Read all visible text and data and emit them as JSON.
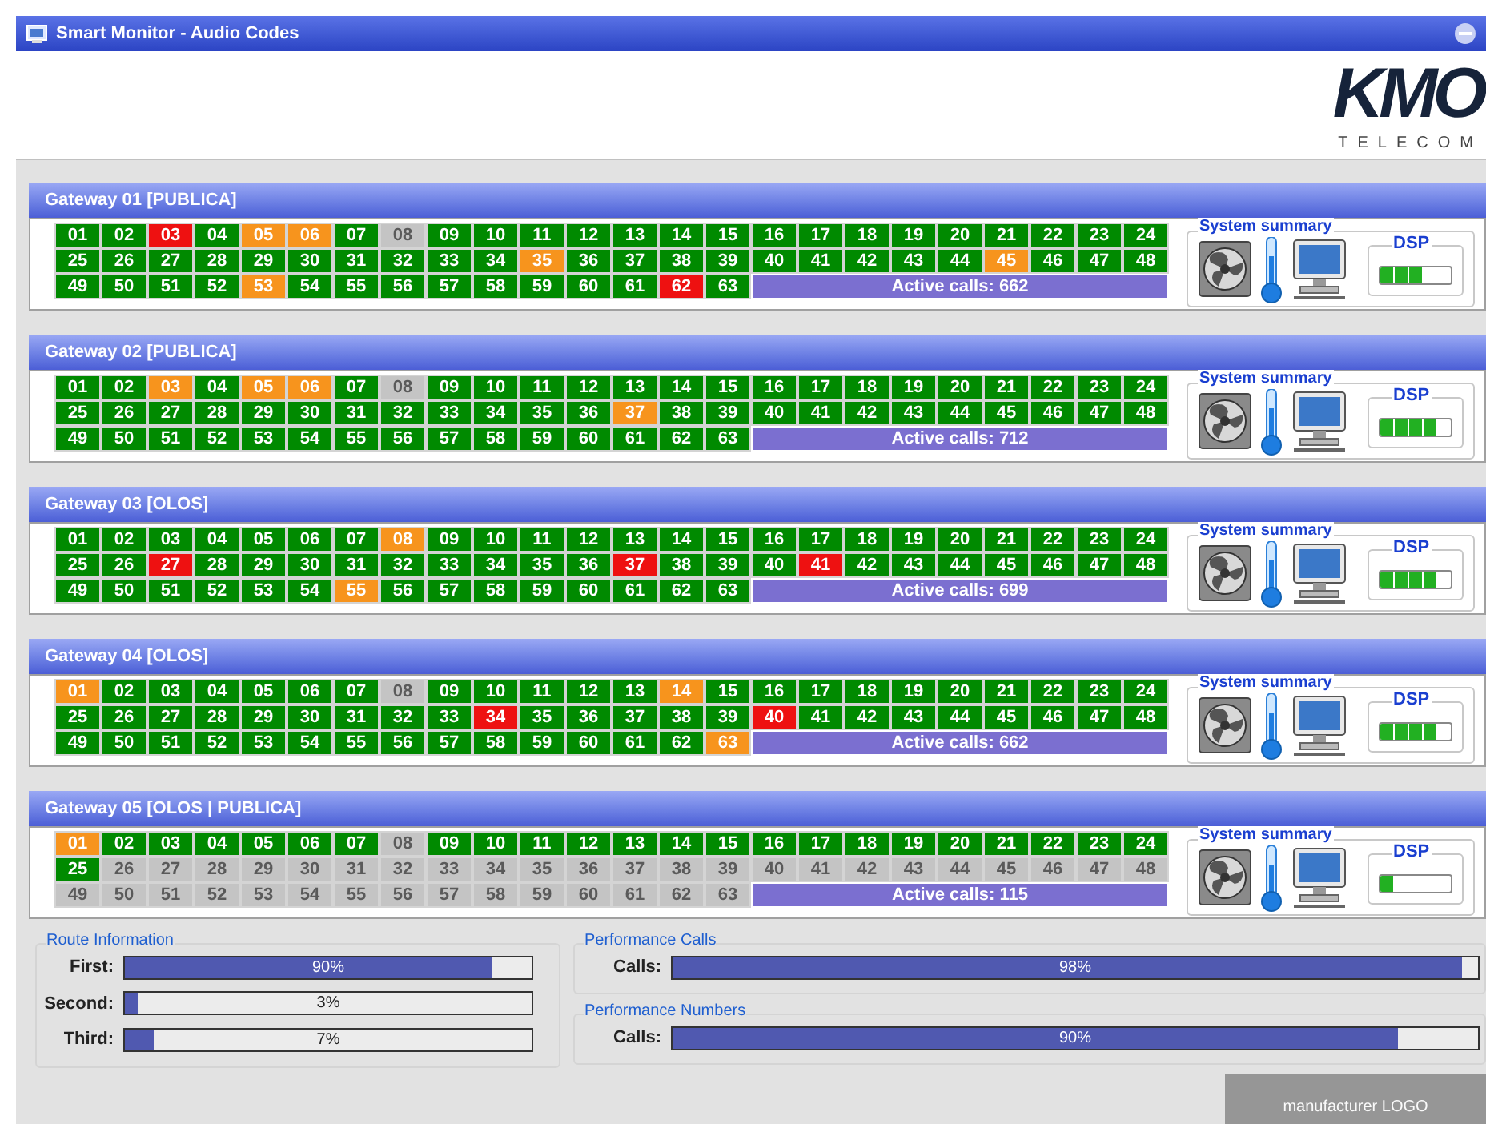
{
  "window": {
    "title": "Smart Monitor - Audio Codes"
  },
  "logo": {
    "mark": "KMO",
    "tagline": "TELECOM"
  },
  "gateways": [
    {
      "title": "Gateway 01 [PUBLICA]",
      "active_calls": "Active calls: 662",
      "summary": {
        "title": "System summary",
        "dsp": {
          "label": "DSP",
          "level": 0.6
        }
      },
      "channels": [
        {
          "n": "01",
          "color": "#008a00"
        },
        {
          "n": "02",
          "color": "#008a00"
        },
        {
          "n": "03",
          "color": "#ee1111"
        },
        {
          "n": "04",
          "color": "#008a00"
        },
        {
          "n": "05",
          "color": "#f7941d"
        },
        {
          "n": "06",
          "color": "#f7941d"
        },
        {
          "n": "07",
          "color": "#008a00"
        },
        {
          "n": "08",
          "color": "#c4c4c4"
        },
        {
          "n": "09",
          "color": "#008a00"
        },
        {
          "n": "10",
          "color": "#008a00"
        },
        {
          "n": "11",
          "color": "#008a00"
        },
        {
          "n": "12",
          "color": "#008a00"
        },
        {
          "n": "13",
          "color": "#008a00"
        },
        {
          "n": "14",
          "color": "#008a00"
        },
        {
          "n": "15",
          "color": "#008a00"
        },
        {
          "n": "16",
          "color": "#008a00"
        },
        {
          "n": "17",
          "color": "#008a00"
        },
        {
          "n": "18",
          "color": "#008a00"
        },
        {
          "n": "19",
          "color": "#008a00"
        },
        {
          "n": "20",
          "color": "#008a00"
        },
        {
          "n": "21",
          "color": "#008a00"
        },
        {
          "n": "22",
          "color": "#008a00"
        },
        {
          "n": "23",
          "color": "#008a00"
        },
        {
          "n": "24",
          "color": "#008a00"
        },
        {
          "n": "25",
          "color": "#008a00"
        },
        {
          "n": "26",
          "color": "#008a00"
        },
        {
          "n": "27",
          "color": "#008a00"
        },
        {
          "n": "28",
          "color": "#008a00"
        },
        {
          "n": "29",
          "color": "#008a00"
        },
        {
          "n": "30",
          "color": "#008a00"
        },
        {
          "n": "31",
          "color": "#008a00"
        },
        {
          "n": "32",
          "color": "#008a00"
        },
        {
          "n": "33",
          "color": "#008a00"
        },
        {
          "n": "34",
          "color": "#008a00"
        },
        {
          "n": "35",
          "color": "#f7941d"
        },
        {
          "n": "36",
          "color": "#008a00"
        },
        {
          "n": "37",
          "color": "#008a00"
        },
        {
          "n": "38",
          "color": "#008a00"
        },
        {
          "n": "39",
          "color": "#008a00"
        },
        {
          "n": "40",
          "color": "#008a00"
        },
        {
          "n": "41",
          "color": "#008a00"
        },
        {
          "n": "42",
          "color": "#008a00"
        },
        {
          "n": "43",
          "color": "#008a00"
        },
        {
          "n": "44",
          "color": "#008a00"
        },
        {
          "n": "45",
          "color": "#f7941d"
        },
        {
          "n": "46",
          "color": "#008a00"
        },
        {
          "n": "47",
          "color": "#008a00"
        },
        {
          "n": "48",
          "color": "#008a00"
        },
        {
          "n": "49",
          "color": "#008a00"
        },
        {
          "n": "50",
          "color": "#008a00"
        },
        {
          "n": "51",
          "color": "#008a00"
        },
        {
          "n": "52",
          "color": "#008a00"
        },
        {
          "n": "53",
          "color": "#f7941d"
        },
        {
          "n": "54",
          "color": "#008a00"
        },
        {
          "n": "55",
          "color": "#008a00"
        },
        {
          "n": "56",
          "color": "#008a00"
        },
        {
          "n": "57",
          "color": "#008a00"
        },
        {
          "n": "58",
          "color": "#008a00"
        },
        {
          "n": "59",
          "color": "#008a00"
        },
        {
          "n": "60",
          "color": "#008a00"
        },
        {
          "n": "61",
          "color": "#008a00"
        },
        {
          "n": "62",
          "color": "#ee1111"
        },
        {
          "n": "63",
          "color": "#008a00"
        }
      ]
    },
    {
      "title": "Gateway 02 [PUBLICA]",
      "active_calls": "Active calls: 712",
      "summary": {
        "title": "System summary",
        "dsp": {
          "label": "DSP",
          "level": 0.8
        }
      },
      "channels": [
        {
          "n": "01",
          "color": "#008a00"
        },
        {
          "n": "02",
          "color": "#008a00"
        },
        {
          "n": "03",
          "color": "#f7941d"
        },
        {
          "n": "04",
          "color": "#008a00"
        },
        {
          "n": "05",
          "color": "#f7941d"
        },
        {
          "n": "06",
          "color": "#f7941d"
        },
        {
          "n": "07",
          "color": "#008a00"
        },
        {
          "n": "08",
          "color": "#c4c4c4"
        },
        {
          "n": "09",
          "color": "#008a00"
        },
        {
          "n": "10",
          "color": "#008a00"
        },
        {
          "n": "11",
          "color": "#008a00"
        },
        {
          "n": "12",
          "color": "#008a00"
        },
        {
          "n": "13",
          "color": "#008a00"
        },
        {
          "n": "14",
          "color": "#008a00"
        },
        {
          "n": "15",
          "color": "#008a00"
        },
        {
          "n": "16",
          "color": "#008a00"
        },
        {
          "n": "17",
          "color": "#008a00"
        },
        {
          "n": "18",
          "color": "#008a00"
        },
        {
          "n": "19",
          "color": "#008a00"
        },
        {
          "n": "20",
          "color": "#008a00"
        },
        {
          "n": "21",
          "color": "#008a00"
        },
        {
          "n": "22",
          "color": "#008a00"
        },
        {
          "n": "23",
          "color": "#008a00"
        },
        {
          "n": "24",
          "color": "#008a00"
        },
        {
          "n": "25",
          "color": "#008a00"
        },
        {
          "n": "26",
          "color": "#008a00"
        },
        {
          "n": "27",
          "color": "#008a00"
        },
        {
          "n": "28",
          "color": "#008a00"
        },
        {
          "n": "29",
          "color": "#008a00"
        },
        {
          "n": "30",
          "color": "#008a00"
        },
        {
          "n": "31",
          "color": "#008a00"
        },
        {
          "n": "32",
          "color": "#008a00"
        },
        {
          "n": "33",
          "color": "#008a00"
        },
        {
          "n": "34",
          "color": "#008a00"
        },
        {
          "n": "35",
          "color": "#008a00"
        },
        {
          "n": "36",
          "color": "#008a00"
        },
        {
          "n": "37",
          "color": "#f7941d"
        },
        {
          "n": "38",
          "color": "#008a00"
        },
        {
          "n": "39",
          "color": "#008a00"
        },
        {
          "n": "40",
          "color": "#008a00"
        },
        {
          "n": "41",
          "color": "#008a00"
        },
        {
          "n": "42",
          "color": "#008a00"
        },
        {
          "n": "43",
          "color": "#008a00"
        },
        {
          "n": "44",
          "color": "#008a00"
        },
        {
          "n": "45",
          "color": "#008a00"
        },
        {
          "n": "46",
          "color": "#008a00"
        },
        {
          "n": "47",
          "color": "#008a00"
        },
        {
          "n": "48",
          "color": "#008a00"
        },
        {
          "n": "49",
          "color": "#008a00"
        },
        {
          "n": "50",
          "color": "#008a00"
        },
        {
          "n": "51",
          "color": "#008a00"
        },
        {
          "n": "52",
          "color": "#008a00"
        },
        {
          "n": "53",
          "color": "#008a00"
        },
        {
          "n": "54",
          "color": "#008a00"
        },
        {
          "n": "55",
          "color": "#008a00"
        },
        {
          "n": "56",
          "color": "#008a00"
        },
        {
          "n": "57",
          "color": "#008a00"
        },
        {
          "n": "58",
          "color": "#008a00"
        },
        {
          "n": "59",
          "color": "#008a00"
        },
        {
          "n": "60",
          "color": "#008a00"
        },
        {
          "n": "61",
          "color": "#008a00"
        },
        {
          "n": "62",
          "color": "#008a00"
        },
        {
          "n": "63",
          "color": "#008a00"
        }
      ]
    },
    {
      "title": "Gateway 03 [OLOS]",
      "active_calls": "Active calls: 699",
      "summary": {
        "title": "System summary",
        "dsp": {
          "label": "DSP",
          "level": 0.8
        }
      },
      "channels": [
        {
          "n": "01",
          "color": "#008a00"
        },
        {
          "n": "02",
          "color": "#008a00"
        },
        {
          "n": "03",
          "color": "#008a00"
        },
        {
          "n": "04",
          "color": "#008a00"
        },
        {
          "n": "05",
          "color": "#008a00"
        },
        {
          "n": "06",
          "color": "#008a00"
        },
        {
          "n": "07",
          "color": "#008a00"
        },
        {
          "n": "08",
          "color": "#f7941d"
        },
        {
          "n": "09",
          "color": "#008a00"
        },
        {
          "n": "10",
          "color": "#008a00"
        },
        {
          "n": "11",
          "color": "#008a00"
        },
        {
          "n": "12",
          "color": "#008a00"
        },
        {
          "n": "13",
          "color": "#008a00"
        },
        {
          "n": "14",
          "color": "#008a00"
        },
        {
          "n": "15",
          "color": "#008a00"
        },
        {
          "n": "16",
          "color": "#008a00"
        },
        {
          "n": "17",
          "color": "#008a00"
        },
        {
          "n": "18",
          "color": "#008a00"
        },
        {
          "n": "19",
          "color": "#008a00"
        },
        {
          "n": "20",
          "color": "#008a00"
        },
        {
          "n": "21",
          "color": "#008a00"
        },
        {
          "n": "22",
          "color": "#008a00"
        },
        {
          "n": "23",
          "color": "#008a00"
        },
        {
          "n": "24",
          "color": "#008a00"
        },
        {
          "n": "25",
          "color": "#008a00"
        },
        {
          "n": "26",
          "color": "#008a00"
        },
        {
          "n": "27",
          "color": "#ee1111"
        },
        {
          "n": "28",
          "color": "#008a00"
        },
        {
          "n": "29",
          "color": "#008a00"
        },
        {
          "n": "30",
          "color": "#008a00"
        },
        {
          "n": "31",
          "color": "#008a00"
        },
        {
          "n": "32",
          "color": "#008a00"
        },
        {
          "n": "33",
          "color": "#008a00"
        },
        {
          "n": "34",
          "color": "#008a00"
        },
        {
          "n": "35",
          "color": "#008a00"
        },
        {
          "n": "36",
          "color": "#008a00"
        },
        {
          "n": "37",
          "color": "#ee1111"
        },
        {
          "n": "38",
          "color": "#008a00"
        },
        {
          "n": "39",
          "color": "#008a00"
        },
        {
          "n": "40",
          "color": "#008a00"
        },
        {
          "n": "41",
          "color": "#ee1111"
        },
        {
          "n": "42",
          "color": "#008a00"
        },
        {
          "n": "43",
          "color": "#008a00"
        },
        {
          "n": "44",
          "color": "#008a00"
        },
        {
          "n": "45",
          "color": "#008a00"
        },
        {
          "n": "46",
          "color": "#008a00"
        },
        {
          "n": "47",
          "color": "#008a00"
        },
        {
          "n": "48",
          "color": "#008a00"
        },
        {
          "n": "49",
          "color": "#008a00"
        },
        {
          "n": "50",
          "color": "#008a00"
        },
        {
          "n": "51",
          "color": "#008a00"
        },
        {
          "n": "52",
          "color": "#008a00"
        },
        {
          "n": "53",
          "color": "#008a00"
        },
        {
          "n": "54",
          "color": "#008a00"
        },
        {
          "n": "55",
          "color": "#f7941d"
        },
        {
          "n": "56",
          "color": "#008a00"
        },
        {
          "n": "57",
          "color": "#008a00"
        },
        {
          "n": "58",
          "color": "#008a00"
        },
        {
          "n": "59",
          "color": "#008a00"
        },
        {
          "n": "60",
          "color": "#008a00"
        },
        {
          "n": "61",
          "color": "#008a00"
        },
        {
          "n": "62",
          "color": "#008a00"
        },
        {
          "n": "63",
          "color": "#008a00"
        }
      ]
    },
    {
      "title": "Gateway 04 [OLOS]",
      "active_calls": "Active calls: 662",
      "summary": {
        "title": "System summary",
        "dsp": {
          "label": "DSP",
          "level": 0.8
        }
      },
      "channels": [
        {
          "n": "01",
          "color": "#f7941d"
        },
        {
          "n": "02",
          "color": "#008a00"
        },
        {
          "n": "03",
          "color": "#008a00"
        },
        {
          "n": "04",
          "color": "#008a00"
        },
        {
          "n": "05",
          "color": "#008a00"
        },
        {
          "n": "06",
          "color": "#008a00"
        },
        {
          "n": "07",
          "color": "#008a00"
        },
        {
          "n": "08",
          "color": "#c4c4c4"
        },
        {
          "n": "09",
          "color": "#008a00"
        },
        {
          "n": "10",
          "color": "#008a00"
        },
        {
          "n": "11",
          "color": "#008a00"
        },
        {
          "n": "12",
          "color": "#008a00"
        },
        {
          "n": "13",
          "color": "#008a00"
        },
        {
          "n": "14",
          "color": "#f7941d"
        },
        {
          "n": "15",
          "color": "#008a00"
        },
        {
          "n": "16",
          "color": "#008a00"
        },
        {
          "n": "17",
          "color": "#008a00"
        },
        {
          "n": "18",
          "color": "#008a00"
        },
        {
          "n": "19",
          "color": "#008a00"
        },
        {
          "n": "20",
          "color": "#008a00"
        },
        {
          "n": "21",
          "color": "#008a00"
        },
        {
          "n": "22",
          "color": "#008a00"
        },
        {
          "n": "23",
          "color": "#008a00"
        },
        {
          "n": "24",
          "color": "#008a00"
        },
        {
          "n": "25",
          "color": "#008a00"
        },
        {
          "n": "26",
          "color": "#008a00"
        },
        {
          "n": "27",
          "color": "#008a00"
        },
        {
          "n": "28",
          "color": "#008a00"
        },
        {
          "n": "29",
          "color": "#008a00"
        },
        {
          "n": "30",
          "color": "#008a00"
        },
        {
          "n": "31",
          "color": "#008a00"
        },
        {
          "n": "32",
          "color": "#008a00"
        },
        {
          "n": "33",
          "color": "#008a00"
        },
        {
          "n": "34",
          "color": "#ee1111"
        },
        {
          "n": "35",
          "color": "#008a00"
        },
        {
          "n": "36",
          "color": "#008a00"
        },
        {
          "n": "37",
          "color": "#008a00"
        },
        {
          "n": "38",
          "color": "#008a00"
        },
        {
          "n": "39",
          "color": "#008a00"
        },
        {
          "n": "40",
          "color": "#ee1111"
        },
        {
          "n": "41",
          "color": "#008a00"
        },
        {
          "n": "42",
          "color": "#008a00"
        },
        {
          "n": "43",
          "color": "#008a00"
        },
        {
          "n": "44",
          "color": "#008a00"
        },
        {
          "n": "45",
          "color": "#008a00"
        },
        {
          "n": "46",
          "color": "#008a00"
        },
        {
          "n": "47",
          "color": "#008a00"
        },
        {
          "n": "48",
          "color": "#008a00"
        },
        {
          "n": "49",
          "color": "#008a00"
        },
        {
          "n": "50",
          "color": "#008a00"
        },
        {
          "n": "51",
          "color": "#008a00"
        },
        {
          "n": "52",
          "color": "#008a00"
        },
        {
          "n": "53",
          "color": "#008a00"
        },
        {
          "n": "54",
          "color": "#008a00"
        },
        {
          "n": "55",
          "color": "#008a00"
        },
        {
          "n": "56",
          "color": "#008a00"
        },
        {
          "n": "57",
          "color": "#008a00"
        },
        {
          "n": "58",
          "color": "#008a00"
        },
        {
          "n": "59",
          "color": "#008a00"
        },
        {
          "n": "60",
          "color": "#008a00"
        },
        {
          "n": "61",
          "color": "#008a00"
        },
        {
          "n": "62",
          "color": "#008a00"
        },
        {
          "n": "63",
          "color": "#f7941d"
        }
      ]
    },
    {
      "title": "Gateway 05 [OLOS | PUBLICA]",
      "active_calls": "Active calls: 115",
      "summary": {
        "title": "System summary",
        "dsp": {
          "label": "DSP",
          "level": 0.2
        }
      },
      "channels": [
        {
          "n": "01",
          "color": "#f7941d"
        },
        {
          "n": "02",
          "color": "#008a00"
        },
        {
          "n": "03",
          "color": "#008a00"
        },
        {
          "n": "04",
          "color": "#008a00"
        },
        {
          "n": "05",
          "color": "#008a00"
        },
        {
          "n": "06",
          "color": "#008a00"
        },
        {
          "n": "07",
          "color": "#008a00"
        },
        {
          "n": "08",
          "color": "#c4c4c4"
        },
        {
          "n": "09",
          "color": "#008a00"
        },
        {
          "n": "10",
          "color": "#008a00"
        },
        {
          "n": "11",
          "color": "#008a00"
        },
        {
          "n": "12",
          "color": "#008a00"
        },
        {
          "n": "13",
          "color": "#008a00"
        },
        {
          "n": "14",
          "color": "#008a00"
        },
        {
          "n": "15",
          "color": "#008a00"
        },
        {
          "n": "16",
          "color": "#008a00"
        },
        {
          "n": "17",
          "color": "#008a00"
        },
        {
          "n": "18",
          "color": "#008a00"
        },
        {
          "n": "19",
          "color": "#008a00"
        },
        {
          "n": "20",
          "color": "#008a00"
        },
        {
          "n": "21",
          "color": "#008a00"
        },
        {
          "n": "22",
          "color": "#008a00"
        },
        {
          "n": "23",
          "color": "#008a00"
        },
        {
          "n": "24",
          "color": "#008a00"
        },
        {
          "n": "25",
          "color": "#008a00"
        },
        {
          "n": "26",
          "color": "#c4c4c4"
        },
        {
          "n": "27",
          "color": "#c4c4c4"
        },
        {
          "n": "28",
          "color": "#c4c4c4"
        },
        {
          "n": "29",
          "color": "#c4c4c4"
        },
        {
          "n": "30",
          "color": "#c4c4c4"
        },
        {
          "n": "31",
          "color": "#c4c4c4"
        },
        {
          "n": "32",
          "color": "#c4c4c4"
        },
        {
          "n": "33",
          "color": "#c4c4c4"
        },
        {
          "n": "34",
          "color": "#c4c4c4"
        },
        {
          "n": "35",
          "color": "#c4c4c4"
        },
        {
          "n": "36",
          "color": "#c4c4c4"
        },
        {
          "n": "37",
          "color": "#c4c4c4"
        },
        {
          "n": "38",
          "color": "#c4c4c4"
        },
        {
          "n": "39",
          "color": "#c4c4c4"
        },
        {
          "n": "40",
          "color": "#c4c4c4"
        },
        {
          "n": "41",
          "color": "#c4c4c4"
        },
        {
          "n": "42",
          "color": "#c4c4c4"
        },
        {
          "n": "43",
          "color": "#c4c4c4"
        },
        {
          "n": "44",
          "color": "#c4c4c4"
        },
        {
          "n": "45",
          "color": "#c4c4c4"
        },
        {
          "n": "46",
          "color": "#c4c4c4"
        },
        {
          "n": "47",
          "color": "#c4c4c4"
        },
        {
          "n": "48",
          "color": "#c4c4c4"
        },
        {
          "n": "49",
          "color": "#c4c4c4"
        },
        {
          "n": "50",
          "color": "#c4c4c4"
        },
        {
          "n": "51",
          "color": "#c4c4c4"
        },
        {
          "n": "52",
          "color": "#c4c4c4"
        },
        {
          "n": "53",
          "color": "#c4c4c4"
        },
        {
          "n": "54",
          "color": "#c4c4c4"
        },
        {
          "n": "55",
          "color": "#c4c4c4"
        },
        {
          "n": "56",
          "color": "#c4c4c4"
        },
        {
          "n": "57",
          "color": "#c4c4c4"
        },
        {
          "n": "58",
          "color": "#c4c4c4"
        },
        {
          "n": "59",
          "color": "#c4c4c4"
        },
        {
          "n": "60",
          "color": "#c4c4c4"
        },
        {
          "n": "61",
          "color": "#c4c4c4"
        },
        {
          "n": "62",
          "color": "#c4c4c4"
        },
        {
          "n": "63",
          "color": "#c4c4c4"
        }
      ]
    }
  ],
  "route_information": {
    "title": "Route Information",
    "rows": [
      {
        "label": "First:",
        "level": 0.9,
        "reading": "90%"
      },
      {
        "label": "Second:",
        "level": 0.03,
        "reading": "3%"
      },
      {
        "label": "Third:",
        "level": 0.07,
        "reading": "7%"
      }
    ]
  },
  "performance_calls": {
    "title": "Performance Calls",
    "rows": [
      {
        "label": "Calls:",
        "level": 0.98,
        "reading": "98%"
      }
    ]
  },
  "performance_numbers": {
    "title": "Performance Numbers",
    "rows": [
      {
        "label": "Calls:",
        "level": 0.9,
        "reading": "90%"
      }
    ]
  },
  "footer": {
    "logo_text": "manufacturer LOGO"
  }
}
